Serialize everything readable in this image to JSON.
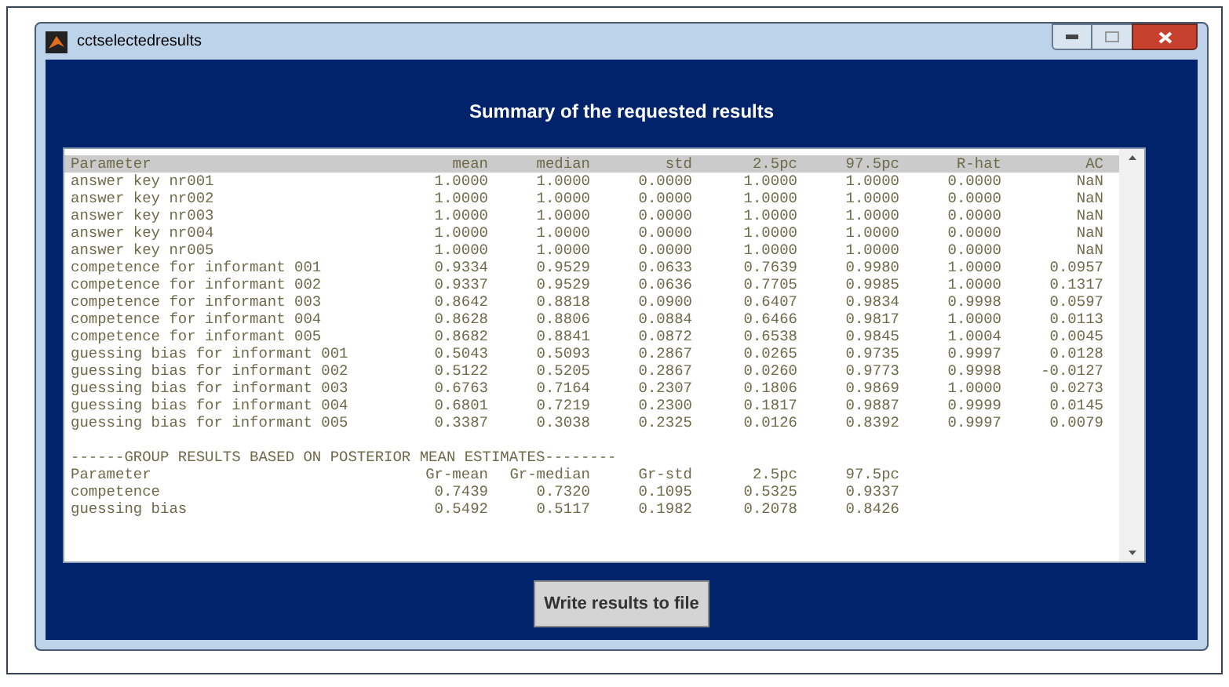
{
  "window": {
    "title": "cctselectedresults"
  },
  "heading": "Summary of the requested results",
  "results_table": {
    "columns": [
      "Parameter",
      "mean",
      "median",
      "std",
      "2.5pc",
      "97.5pc",
      "R-hat",
      "AC"
    ],
    "rows": [
      [
        "answer key nr001",
        "1.0000",
        "1.0000",
        "0.0000",
        "1.0000",
        "1.0000",
        "0.0000",
        "NaN"
      ],
      [
        "answer key nr002",
        "1.0000",
        "1.0000",
        "0.0000",
        "1.0000",
        "1.0000",
        "0.0000",
        "NaN"
      ],
      [
        "answer key nr003",
        "1.0000",
        "1.0000",
        "0.0000",
        "1.0000",
        "1.0000",
        "0.0000",
        "NaN"
      ],
      [
        "answer key nr004",
        "1.0000",
        "1.0000",
        "0.0000",
        "1.0000",
        "1.0000",
        "0.0000",
        "NaN"
      ],
      [
        "answer key nr005",
        "1.0000",
        "1.0000",
        "0.0000",
        "1.0000",
        "1.0000",
        "0.0000",
        "NaN"
      ],
      [
        "competence for informant 001",
        "0.9334",
        "0.9529",
        "0.0633",
        "0.7639",
        "0.9980",
        "1.0000",
        "0.0957"
      ],
      [
        "competence for informant 002",
        "0.9337",
        "0.9529",
        "0.0636",
        "0.7705",
        "0.9985",
        "1.0000",
        "0.1317"
      ],
      [
        "competence for informant 003",
        "0.8642",
        "0.8818",
        "0.0900",
        "0.6407",
        "0.9834",
        "0.9998",
        "0.0597"
      ],
      [
        "competence for informant 004",
        "0.8628",
        "0.8806",
        "0.0884",
        "0.6466",
        "0.9817",
        "1.0000",
        "0.0113"
      ],
      [
        "competence for informant 005",
        "0.8682",
        "0.8841",
        "0.0872",
        "0.6538",
        "0.9845",
        "1.0004",
        "0.0045"
      ],
      [
        "guessing bias for informant 001",
        "0.5043",
        "0.5093",
        "0.2867",
        "0.0265",
        "0.9735",
        "0.9997",
        "0.0128"
      ],
      [
        "guessing bias for informant 002",
        "0.5122",
        "0.5205",
        "0.2867",
        "0.0260",
        "0.9773",
        "0.9998",
        "-0.0127"
      ],
      [
        "guessing bias for informant 003",
        "0.6763",
        "0.7164",
        "0.2307",
        "0.1806",
        "0.9869",
        "1.0000",
        "0.0273"
      ],
      [
        "guessing bias for informant 004",
        "0.6801",
        "0.7219",
        "0.2300",
        "0.1817",
        "0.9887",
        "0.9999",
        "0.0145"
      ],
      [
        "guessing bias for informant 005",
        "0.3387",
        "0.3038",
        "0.2325",
        "0.0126",
        "0.8392",
        "0.9997",
        "0.0079"
      ]
    ]
  },
  "group_divider": "------GROUP RESULTS BASED ON POSTERIOR MEAN ESTIMATES--------",
  "group_table": {
    "columns": [
      "Parameter",
      "Gr-mean",
      "Gr-median",
      "Gr-std",
      "2.5pc",
      "97.5pc"
    ],
    "rows": [
      [
        "competence",
        "0.7439",
        "0.7320",
        "0.1095",
        "0.5325",
        "0.9337"
      ],
      [
        "guessing bias",
        "0.5492",
        "0.5117",
        "0.1982",
        "0.2078",
        "0.8426"
      ]
    ]
  },
  "button": "Write results to file"
}
